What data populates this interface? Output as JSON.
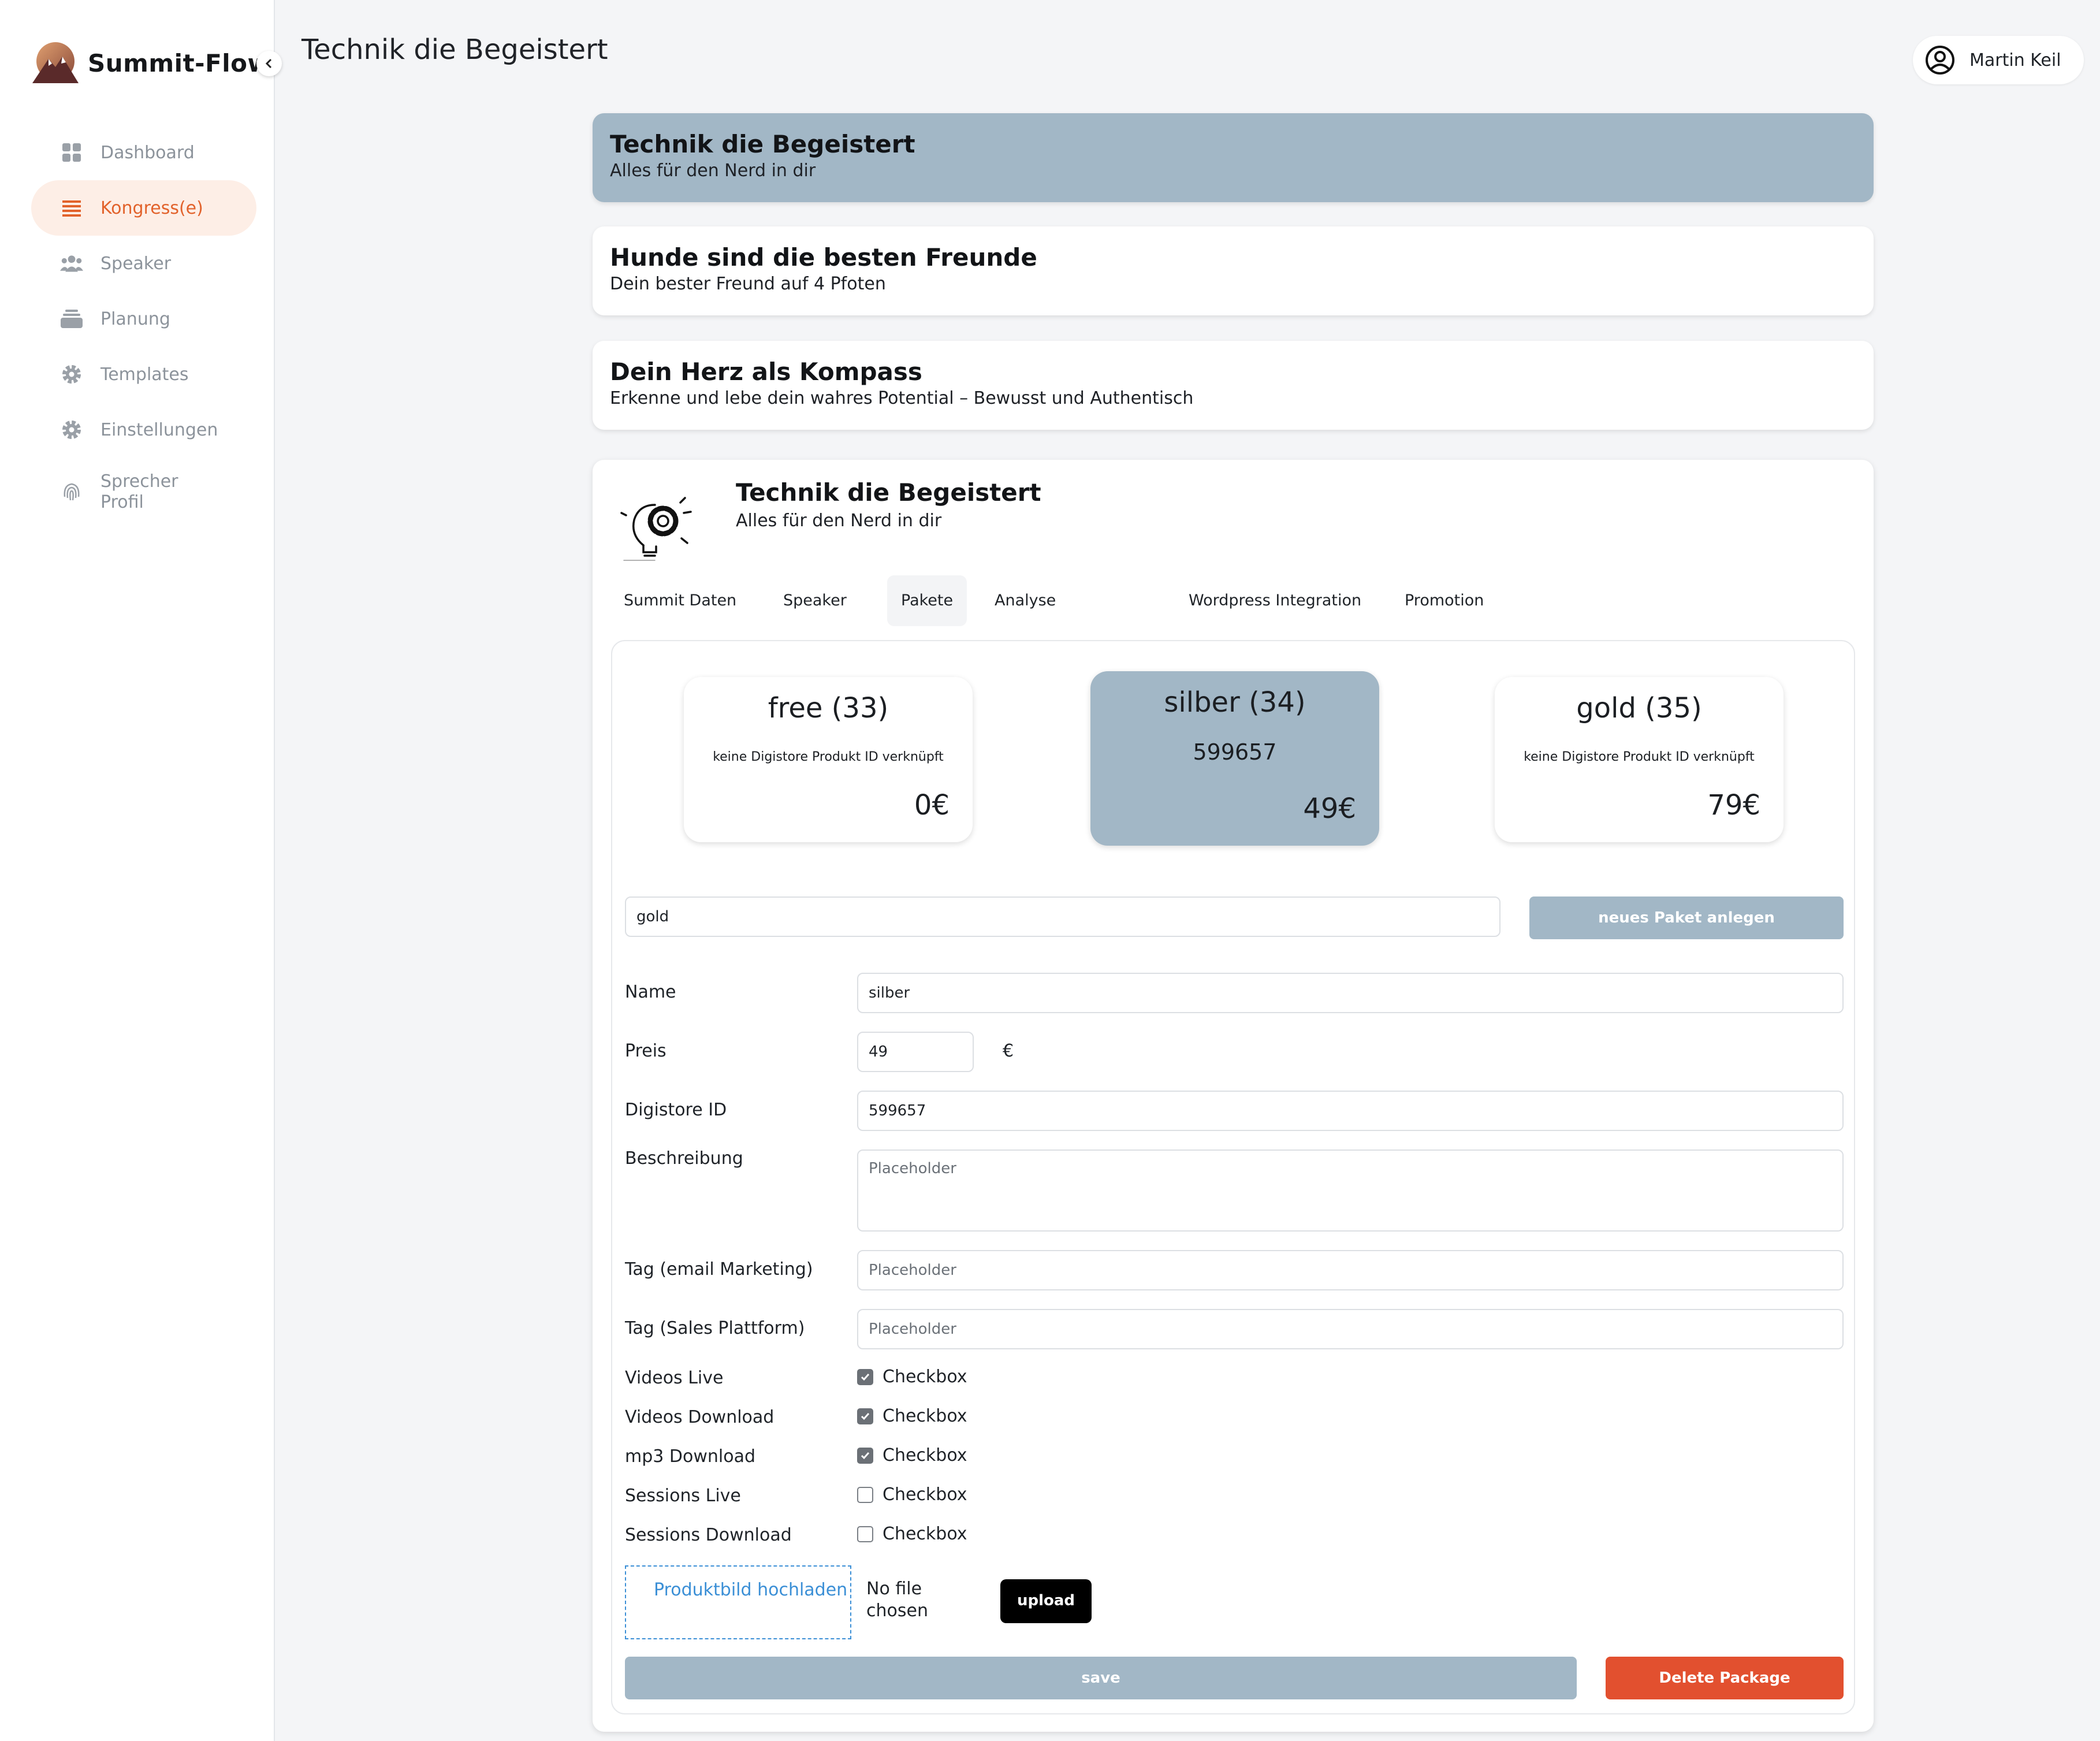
{
  "app": {
    "name": "Summit-Flow",
    "page_title": "Technik die Begeistert"
  },
  "user": {
    "name": "Martin Keil"
  },
  "sidebar": {
    "items": [
      {
        "label": "Dashboard",
        "icon": "dashboard-icon",
        "active": false
      },
      {
        "label": "Kongress(e)",
        "icon": "list-icon",
        "active": true
      },
      {
        "label": "Speaker",
        "icon": "people-icon",
        "active": false
      },
      {
        "label": "Planung",
        "icon": "stack-icon",
        "active": false
      },
      {
        "label": "Templates",
        "icon": "gear-icon",
        "active": false
      },
      {
        "label": "Einstellungen",
        "icon": "gear-icon",
        "active": false
      },
      {
        "label": "Sprecher Profil",
        "icon": "fingerprint-icon",
        "active": false
      }
    ]
  },
  "congresses": [
    {
      "title": "Technik die Begeistert",
      "subtitle": "Alles für den Nerd in dir",
      "selected": true
    },
    {
      "title": "Hunde sind die besten Freunde",
      "subtitle": "Dein bester Freund auf 4 Pfoten",
      "selected": false
    },
    {
      "title": "Dein Herz als Kompass",
      "subtitle": "Erkenne und lebe dein wahres Potential – Bewusst und Authentisch",
      "selected": false
    }
  ],
  "detail": {
    "title": "Technik die Begeistert",
    "subtitle": "Alles für den Nerd in dir",
    "tabs": [
      "Summit Daten",
      "Speaker",
      "Pakete",
      "Analyse",
      "Wordpress Integration",
      "Promotion"
    ],
    "active_tab": "Pakete"
  },
  "packages": [
    {
      "name": "free (33)",
      "digistore": "keine Digistore Produkt ID verknüpft",
      "price": "0€",
      "selected": false
    },
    {
      "name": "silber (34)",
      "digistore": "599657",
      "price": "49€",
      "selected": true
    },
    {
      "name": "gold (35)",
      "digistore": "keine Digistore Produkt ID verknüpft",
      "price": "79€",
      "selected": false
    }
  ],
  "new_package": {
    "input_value": "gold",
    "button_label": "neues Paket anlegen"
  },
  "form": {
    "name_label": "Name",
    "name_value": "silber",
    "price_label": "Preis",
    "price_value": "49",
    "currency": "€",
    "digistore_label": "Digistore ID",
    "digistore_value": "599657",
    "description_label": "Beschreibung",
    "description_placeholder": "Placeholder",
    "tag_email_label": "Tag (email Marketing)",
    "tag_email_placeholder": "Placeholder",
    "tag_sales_label": "Tag (Sales Plattform)",
    "tag_sales_placeholder": "Placeholder",
    "checkboxes": [
      {
        "label": "Videos Live",
        "text": "Checkbox",
        "checked": true
      },
      {
        "label": "Videos Download",
        "text": "Checkbox",
        "checked": true
      },
      {
        "label": "mp3 Download",
        "text": "Checkbox",
        "checked": true
      },
      {
        "label": "Sessions Live",
        "text": "Checkbox",
        "checked": false
      },
      {
        "label": "Sessions Download",
        "text": "Checkbox",
        "checked": false
      }
    ],
    "upload_area_label": "Produktbild hochladen",
    "file_status": "No file chosen",
    "upload_button": "upload",
    "save_button": "save",
    "delete_button": "Delete Package"
  },
  "colors": {
    "accent": "#e2622b",
    "selected_card": "#a2b7c6",
    "danger": "#e2502f",
    "link": "#3b8fd6"
  }
}
